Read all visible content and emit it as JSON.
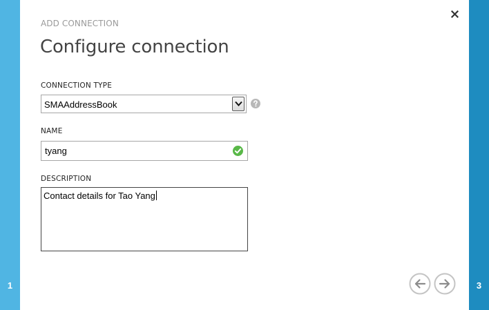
{
  "wizard": {
    "eyebrow": "ADD CONNECTION",
    "title": "Configure connection",
    "steps": {
      "left": "1",
      "right": "3"
    }
  },
  "form": {
    "connection_type": {
      "label": "CONNECTION TYPE",
      "value": "SMAAddressBook"
    },
    "name": {
      "label": "NAME",
      "value": "tyang"
    },
    "description": {
      "label": "DESCRIPTION",
      "value": "Contact details for Tao Yang"
    }
  },
  "icons": {
    "close": "close-icon",
    "help": "help-icon",
    "valid": "checkmark-icon",
    "back": "arrow-left-icon",
    "next": "arrow-right-icon"
  },
  "colors": {
    "left_rail": "#50b5e3",
    "right_rail": "#1e8cc0",
    "valid": "#59b848"
  }
}
